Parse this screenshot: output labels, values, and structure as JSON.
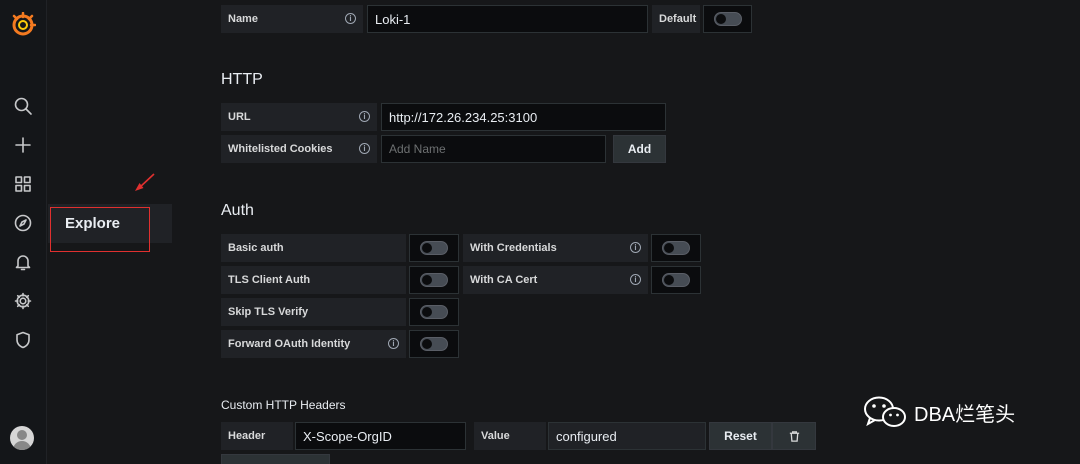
{
  "nav": {
    "items": [
      "grafana-logo-icon",
      "search-icon",
      "plus-icon",
      "dashboards-icon",
      "compass-icon",
      "bell-icon",
      "gear-icon",
      "shield-icon"
    ],
    "flyout_label": "Explore"
  },
  "name_row": {
    "label": "Name",
    "value": "Loki-1",
    "default_label": "Default"
  },
  "http": {
    "title": "HTTP",
    "url_label": "URL",
    "url_value": "http://172.26.234.25:3100",
    "cookies_label": "Whitelisted Cookies",
    "cookies_placeholder": "Add Name",
    "add_label": "Add"
  },
  "auth": {
    "title": "Auth",
    "basic": "Basic auth",
    "with_credentials": "With Credentials",
    "tls_client": "TLS Client Auth",
    "with_ca": "With CA Cert",
    "skip_tls": "Skip TLS Verify",
    "forward_oauth": "Forward OAuth Identity"
  },
  "headers": {
    "title": "Custom HTTP Headers",
    "header_label": "Header",
    "header_value": "X-Scope-OrgID",
    "value_label": "Value",
    "value_value": "configured",
    "reset_label": "Reset"
  },
  "watermark": "DBA烂笔头",
  "colors": {
    "bg": "#161719",
    "panel": "#202226",
    "input": "#0b0c0e",
    "red": "#e0302f",
    "accent": "#f47a20"
  }
}
